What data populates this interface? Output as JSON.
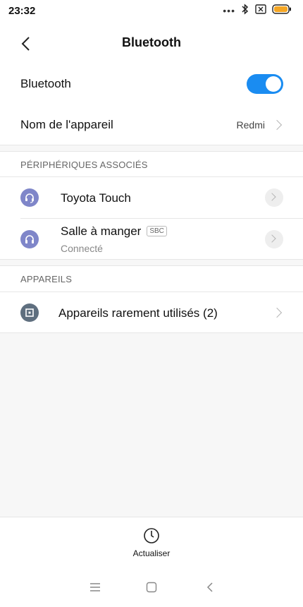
{
  "status_bar": {
    "time": "23:32",
    "icons": [
      "more-dots-icon",
      "bluetooth-icon",
      "sim-x-icon",
      "battery-icon"
    ],
    "battery_color": "#f5a623"
  },
  "header": {
    "title": "Bluetooth",
    "back_icon": "back-arrow-icon"
  },
  "settings": {
    "bluetooth_label": "Bluetooth",
    "bluetooth_enabled": true,
    "device_name_label": "Nom de l'appareil",
    "device_name_value": "Redmi"
  },
  "paired": {
    "section_title": "PÉRIPHÉRIQUES ASSOCIÉS",
    "devices": [
      {
        "name": "Toyota Touch",
        "icon": "headset-icon",
        "badge": "",
        "status": ""
      },
      {
        "name": "Salle à manger",
        "icon": "headphones-icon",
        "badge": "SBC",
        "status": "Connecté"
      }
    ]
  },
  "available": {
    "section_title": "APPAREILS",
    "rare_label": "Appareils rarement utilisés (2)",
    "rare_icon": "device-icon"
  },
  "refresh": {
    "label": "Actualiser",
    "icon": "refresh-icon"
  },
  "nav_bar": {
    "icons": [
      "menu-icon",
      "home-icon",
      "back-icon"
    ]
  },
  "colors": {
    "accent": "#1a8cf1",
    "device_icon_bg": "#7f86c9",
    "rare_icon_bg": "#5f6f7f"
  }
}
